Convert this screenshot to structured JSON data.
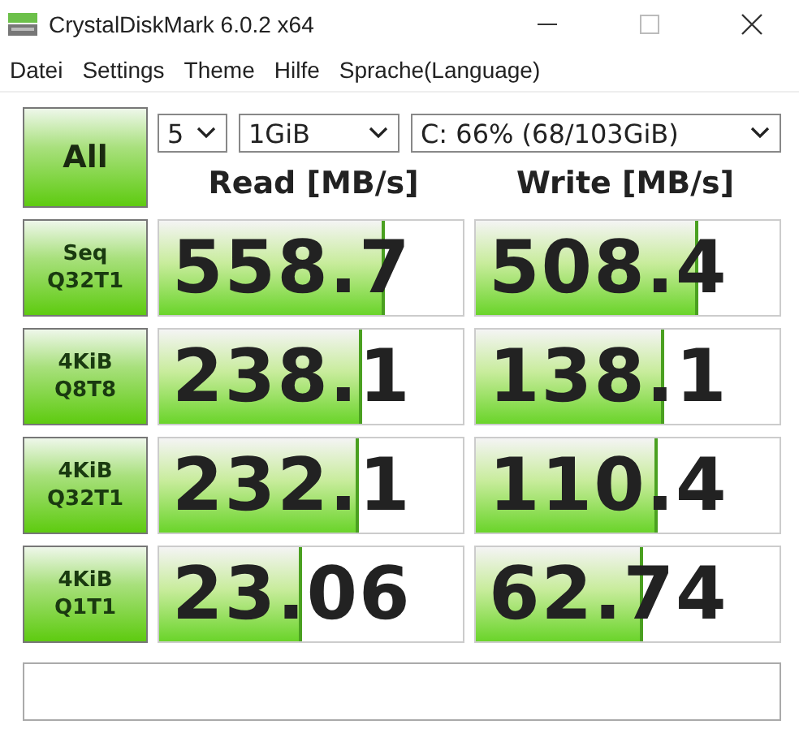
{
  "window": {
    "title": "CrystalDiskMark 6.0.2 x64"
  },
  "menu": [
    "Datei",
    "Settings",
    "Theme",
    "Hilfe",
    "Sprache(Language)"
  ],
  "all_button": "All",
  "selects": {
    "count": "5",
    "size": "1GiB",
    "drive": "C: 66% (68/103GiB)"
  },
  "headers": {
    "read": "Read [MB/s]",
    "write": "Write [MB/s]"
  },
  "tests": [
    {
      "label_1": "Seq",
      "label_2": "Q32T1",
      "read": {
        "value": "558.7",
        "level": 0.745
      },
      "write": {
        "value": "508.4",
        "level": 0.735
      }
    },
    {
      "label_1": "4KiB",
      "label_2": "Q8T8",
      "read": {
        "value": "238.1",
        "level": 0.67
      },
      "write": {
        "value": "138.1",
        "level": 0.62
      }
    },
    {
      "label_1": "4KiB",
      "label_2": "Q32T1",
      "read": {
        "value": "232.1",
        "level": 0.66
      },
      "write": {
        "value": "110.4",
        "level": 0.6
      }
    },
    {
      "label_1": "4KiB",
      "label_2": "Q1T1",
      "read": {
        "value": "23.06",
        "level": 0.47
      },
      "write": {
        "value": "62.74",
        "level": 0.55
      }
    }
  ]
}
